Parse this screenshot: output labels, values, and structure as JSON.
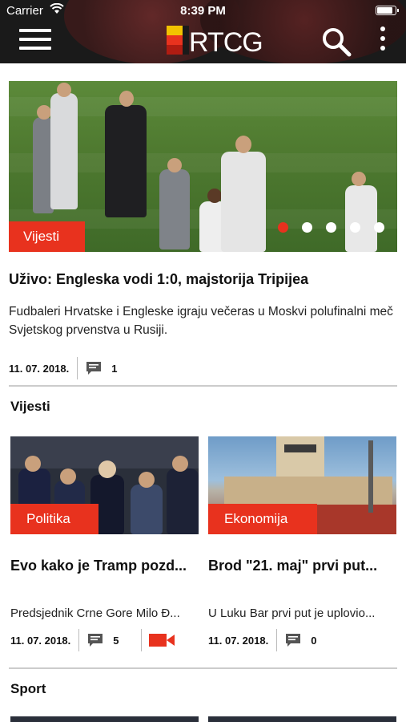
{
  "status_bar": {
    "carrier": "Carrier",
    "time": "8:39 PM"
  },
  "header": {
    "logo_text": "RTCG",
    "menu_icon": "hamburger-icon",
    "search_icon": "search-icon",
    "more_icon": "more-vert-icon"
  },
  "featured": {
    "category": "Vijesti",
    "title": "Uživo: Engleska vodi 1:0, majstorija Tripijea",
    "summary": "Fudbaleri Hrvatske i Engleske igraju večeras u Moskvi polufinalni meč Svjetskog prvenstva u Rusiji.",
    "date": "11. 07. 2018.",
    "comments": "1",
    "carousel_total": 5,
    "carousel_active": 0
  },
  "sections": [
    {
      "title": "Vijesti",
      "cards": [
        {
          "category": "Politika",
          "title": "Evo kako je Tramp pozd...",
          "desc": "Predsjednik Crne Gore Milo Đ...",
          "date": "11. 07. 2018.",
          "comments": "5",
          "has_video": true
        },
        {
          "category": "Ekonomija",
          "title": "Brod \"21. maj\" prvi put...",
          "desc": "U Luku Bar prvi put je uplovio...",
          "date": "11. 07. 2018.",
          "comments": "0",
          "has_video": false
        }
      ]
    },
    {
      "title": "Sport"
    }
  ],
  "colors": {
    "accent": "#e8321e",
    "header_bg": "#1a1a1a",
    "divider": "#cccccc"
  }
}
